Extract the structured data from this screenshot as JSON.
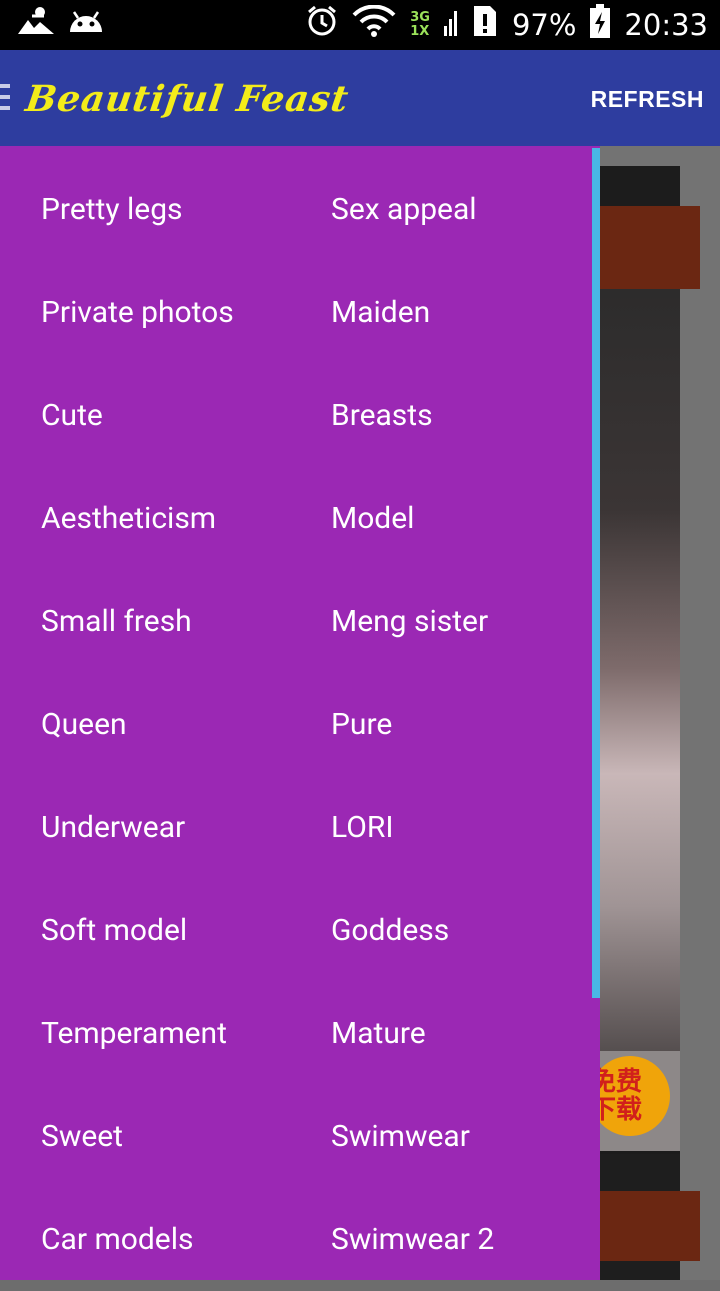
{
  "status_bar": {
    "time": "20:33",
    "battery_percent": "97%",
    "network_top": "3G",
    "network_bottom": "1X",
    "icons": [
      "picture-icon",
      "android-icon",
      "alarm-icon",
      "wifi-icon",
      "signal-icon",
      "sim-alert-icon",
      "battery-charging-icon"
    ]
  },
  "app_bar": {
    "title": "Beautiful Feast",
    "refresh_label": "REFRESH",
    "color": "#2e3d9f",
    "title_color": "#f3ec1a"
  },
  "drawer": {
    "background": "#9b28b4",
    "items": [
      "Pretty legs",
      "Sex appeal",
      "Private photos",
      "Maiden",
      "Cute",
      "Breasts",
      "Aestheticism",
      "Model",
      "Small fresh",
      "Meng sister",
      "Queen",
      "Pure",
      "Underwear",
      "LORI",
      "Soft model",
      "Goddess",
      "Temperament",
      "Mature",
      "Sweet",
      "Swimwear",
      "Car models",
      "Swimwear 2"
    ]
  },
  "background_content": {
    "badge_line1": "免费",
    "badge_line2": "下载"
  }
}
